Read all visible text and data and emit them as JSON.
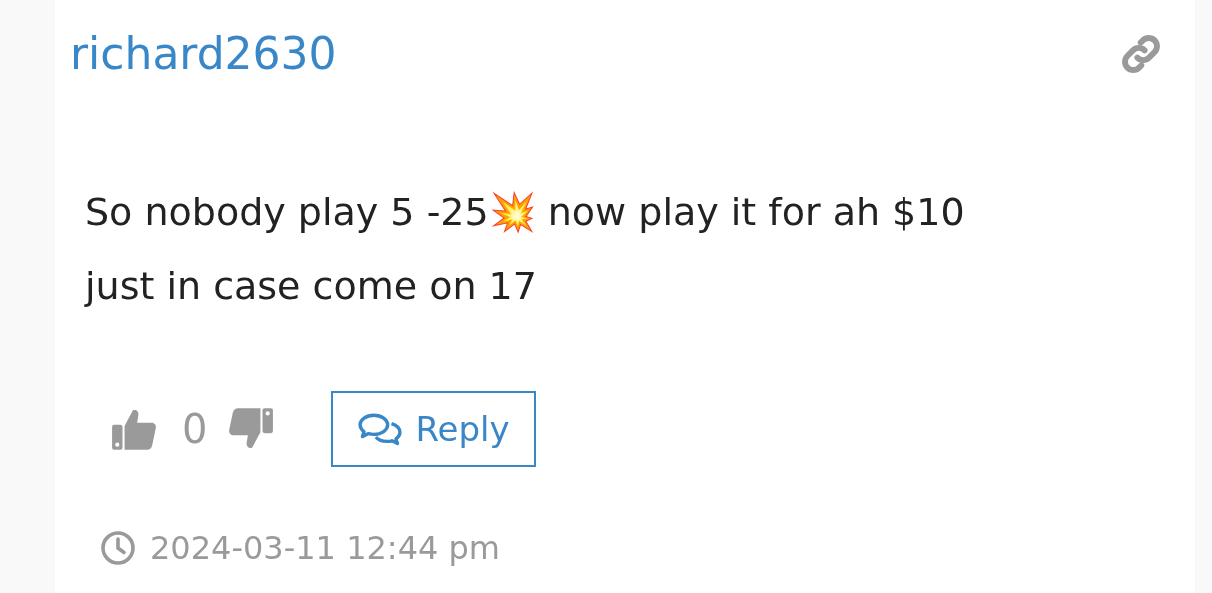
{
  "comment": {
    "author": "richard2630",
    "text": "So nobody play 5 -25💥 now play it for ah $10 just in case come on 17",
    "votes": {
      "count": "0"
    },
    "reply_button": "Reply",
    "timestamp": "2024-03-11 12:44 pm"
  }
}
